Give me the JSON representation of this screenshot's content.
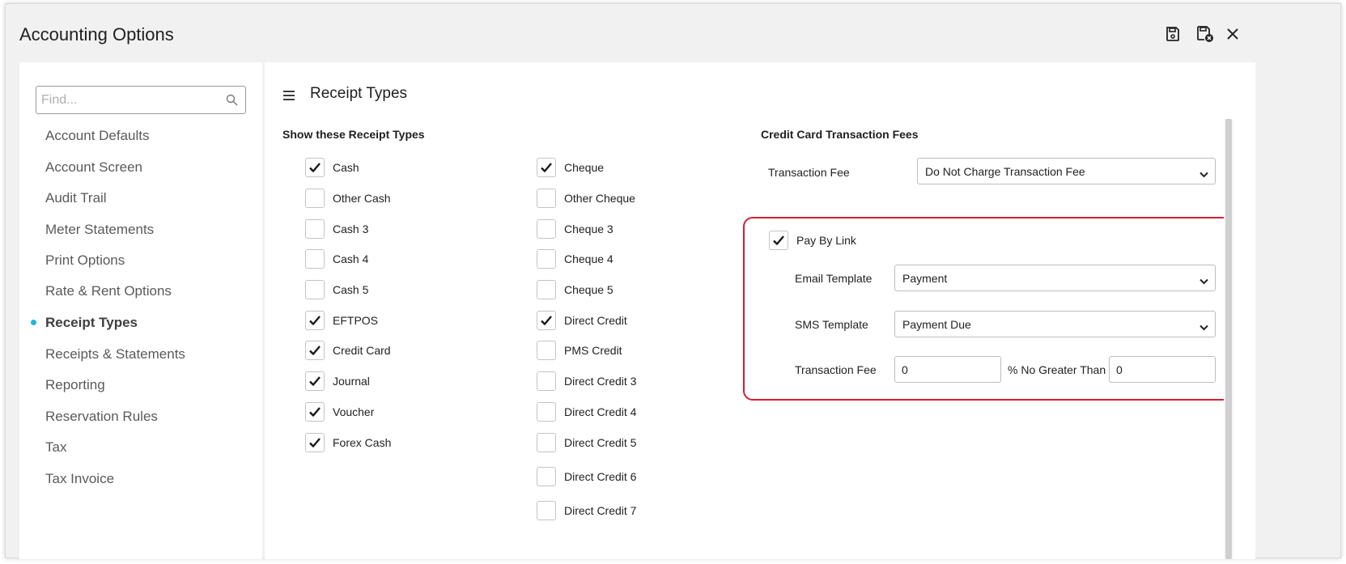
{
  "window": {
    "title": "Accounting Options",
    "actions": {
      "save_icon": "save-icon",
      "save_close_icon": "save-close-icon",
      "close_icon": "close-icon"
    }
  },
  "sidebar": {
    "search_placeholder": "Find...",
    "items": [
      {
        "label": "Account Defaults"
      },
      {
        "label": "Account Screen"
      },
      {
        "label": "Audit Trail"
      },
      {
        "label": "Meter Statements"
      },
      {
        "label": "Print Options"
      },
      {
        "label": "Rate & Rent Options"
      },
      {
        "label": "Receipt Types",
        "active": true
      },
      {
        "label": "Receipts & Statements"
      },
      {
        "label": "Reporting"
      },
      {
        "label": "Reservation Rules"
      },
      {
        "label": "Tax"
      },
      {
        "label": "Tax Invoice"
      }
    ]
  },
  "main": {
    "title": "Receipt Types",
    "receipt_types_heading": "Show these Receipt Types",
    "col1": [
      {
        "label": "Cash",
        "checked": true
      },
      {
        "label": "Other Cash",
        "checked": false
      },
      {
        "label": "Cash 3",
        "checked": false
      },
      {
        "label": "Cash 4",
        "checked": false
      },
      {
        "label": "Cash 5",
        "checked": false
      },
      {
        "label": "EFTPOS",
        "checked": true
      },
      {
        "label": "Credit Card",
        "checked": true
      },
      {
        "label": "Journal",
        "checked": true
      },
      {
        "label": "Voucher",
        "checked": true
      },
      {
        "label": "Forex Cash",
        "checked": true
      }
    ],
    "col2": [
      {
        "label": "Cheque",
        "checked": true
      },
      {
        "label": "Other Cheque",
        "checked": false
      },
      {
        "label": "Cheque 3",
        "checked": false
      },
      {
        "label": "Cheque 4",
        "checked": false
      },
      {
        "label": "Cheque 5",
        "checked": false
      },
      {
        "label": "Direct Credit",
        "checked": true
      },
      {
        "label": "PMS Credit",
        "checked": false
      },
      {
        "label": "Direct Credit 3",
        "checked": false
      },
      {
        "label": "Direct Credit 4",
        "checked": false
      },
      {
        "label": "Direct Credit 5",
        "checked": false
      },
      {
        "label": "Direct Credit 6",
        "checked": false
      },
      {
        "label": "Direct Credit 7",
        "checked": false
      }
    ],
    "cc_fees": {
      "heading": "Credit Card Transaction Fees",
      "transaction_fee_label": "Transaction Fee",
      "transaction_fee_value": "Do Not Charge Transaction Fee"
    },
    "pay_by_link": {
      "label": "Pay By Link",
      "checked": true,
      "email_template_label": "Email Template",
      "email_template_value": "Payment",
      "sms_template_label": "SMS Template",
      "sms_template_value": "Payment Due",
      "transaction_fee_label": "Transaction Fee",
      "transaction_fee_value": "0",
      "no_greater_than_label": "% No Greater Than",
      "no_greater_than_value": "0"
    }
  },
  "colors": {
    "accent": "#22b7d4",
    "highlight": "#d51f33"
  }
}
